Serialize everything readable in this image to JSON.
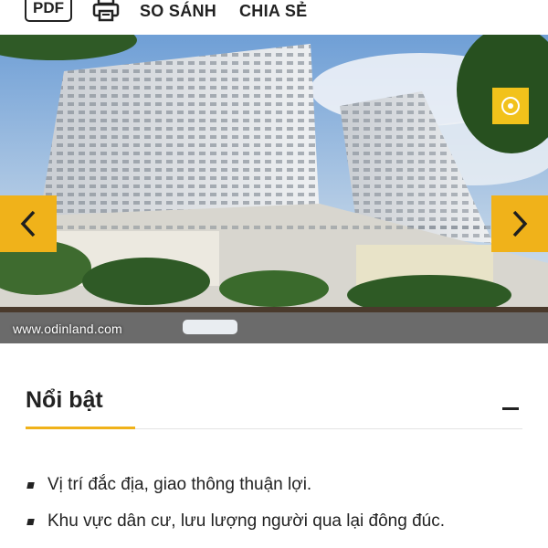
{
  "toolbar": {
    "pdf_label": "PDF",
    "print_icon": "printer-icon",
    "compare_label": "SO SÁNH",
    "share_label": "CHIA SẺ"
  },
  "gallery": {
    "watermark": "www.odinland.com",
    "prev_icon": "chevron-left-icon",
    "next_icon": "chevron-right-icon",
    "brand_icon": "brand-logo-icon",
    "accent_color": "#f0b21a"
  },
  "highlights_section": {
    "title": "Nổi bật",
    "collapse_icon": "minus-icon",
    "items": [
      "Vị trí đắc địa, giao thông thuận lợi.",
      "Khu vực dân cư, lưu lượng người qua lại đông đúc."
    ]
  }
}
